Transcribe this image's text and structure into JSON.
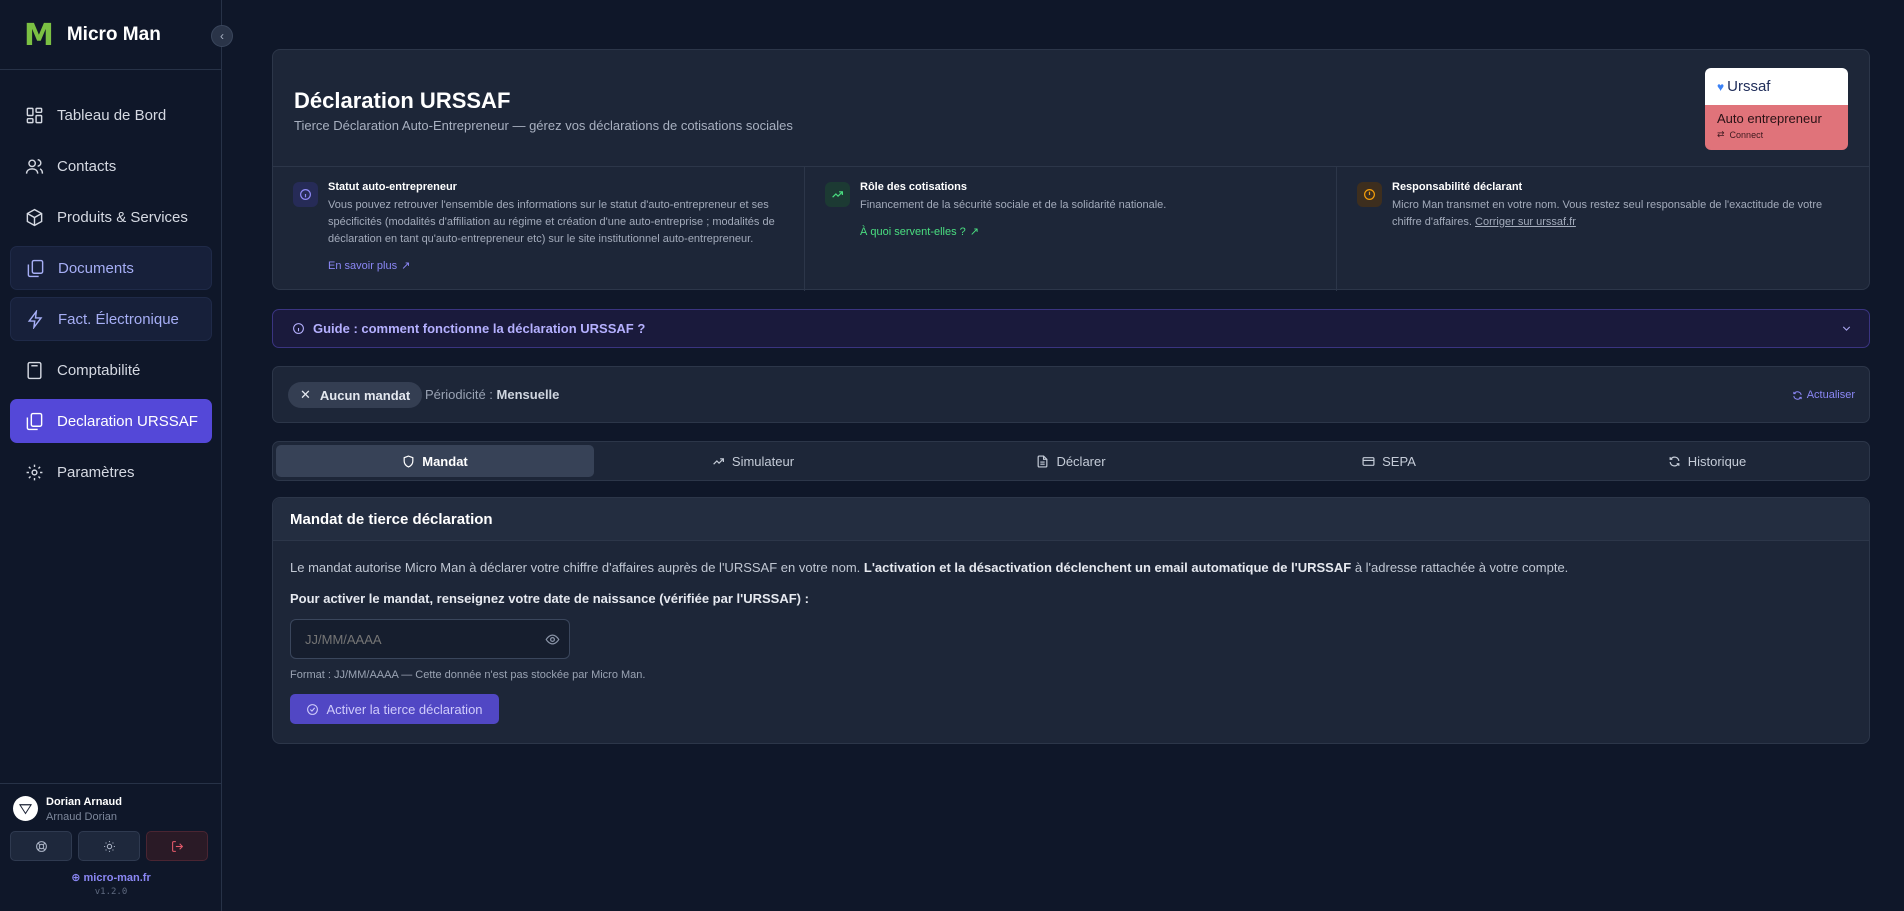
{
  "brand": {
    "logo": "M",
    "name": "Micro Man"
  },
  "sidebar": {
    "items": [
      {
        "label": "Tableau de Bord",
        "icon": "dashboard-icon",
        "state": "normal"
      },
      {
        "label": "Contacts",
        "icon": "users-icon",
        "state": "normal"
      },
      {
        "label": "Produits & Services",
        "icon": "package-icon",
        "state": "normal"
      },
      {
        "label": "Documents",
        "icon": "files-icon",
        "state": "highlight"
      },
      {
        "label": "Fact. Électronique",
        "icon": "lightning-icon",
        "state": "highlight"
      },
      {
        "label": "Comptabilité",
        "icon": "calculator-icon",
        "state": "normal"
      },
      {
        "label": "Declaration URSSAF",
        "icon": "files-icon",
        "state": "active"
      },
      {
        "label": "Paramètres",
        "icon": "gear-icon",
        "state": "normal"
      }
    ]
  },
  "user": {
    "name": "Dorian Arnaud",
    "subtitle": "Arnaud Dorian",
    "site": "micro-man.fr",
    "version": "v1.2.0"
  },
  "header": {
    "title": "Déclaration URSSAF",
    "subtitle": "Tierce Déclaration Auto-Entrepreneur — gérez vos déclarations de cotisations sociales",
    "badge": {
      "brand": "Urssaf",
      "line1": "Auto entrepreneur",
      "line2": "Connect"
    }
  },
  "info": {
    "statut": {
      "title": "Statut auto-entrepreneur",
      "text": "Vous pouvez retrouver l'ensemble des informations sur le statut d'auto-entrepreneur et ses spécificités (modalités d'affiliation au régime et création d'une auto-entreprise ; modalités de déclaration en tant qu'auto-entrepreneur etc) sur le site institutionnel auto-entrepreneur.",
      "link": "En savoir plus"
    },
    "role": {
      "title": "Rôle des cotisations",
      "text": "Financement de la sécurité sociale et de la solidarité nationale.",
      "link": "À quoi servent-elles ?"
    },
    "responsabilite": {
      "title": "Responsabilité déclarant",
      "text": "Micro Man transmet en votre nom. Vous restez seul responsable de l'exactitude de votre chiffre d'affaires.",
      "link": "Corriger sur urssaf.fr"
    }
  },
  "guide": {
    "label": "Guide : comment fonctionne la déclaration URSSAF ?"
  },
  "status": {
    "mandat": "Aucun mandat",
    "periodicity_label": "Périodicité :",
    "periodicity_value": "Mensuelle",
    "refresh": "Actualiser"
  },
  "tabs": [
    {
      "label": "Mandat",
      "icon": "shield-icon",
      "active": true
    },
    {
      "label": "Simulateur",
      "icon": "trending-icon",
      "active": false
    },
    {
      "label": "Déclarer",
      "icon": "document-icon",
      "active": false
    },
    {
      "label": "SEPA",
      "icon": "credit-card-icon",
      "active": false
    },
    {
      "label": "Historique",
      "icon": "refresh-icon",
      "active": false
    }
  ],
  "mandat": {
    "title": "Mandat de tierce déclaration",
    "text_a": "Le mandat autorise Micro Man à déclarer votre chiffre d'affaires auprès de l'URSSAF en votre nom.",
    "text_b": "L'activation et la désactivation déclenchent un email automatique de l'URSSAF",
    "text_c": "à l'adresse rattachée à votre compte.",
    "label": "Pour activer le mandat, renseignez votre date de naissance (vérifiée par l'URSSAF) :",
    "placeholder": "JJ/MM/AAAA",
    "hint": "Format : JJ/MM/AAAA — Cette donnée n'est pas stockée par Micro Man.",
    "button": "Activer la tierce déclaration"
  },
  "colors": {
    "accent": "#5448d8",
    "brand_green": "#7bc043",
    "link": "#8b87f5",
    "success": "#4ade80",
    "warning": "#f59e0b",
    "danger": "#e45a6a"
  }
}
